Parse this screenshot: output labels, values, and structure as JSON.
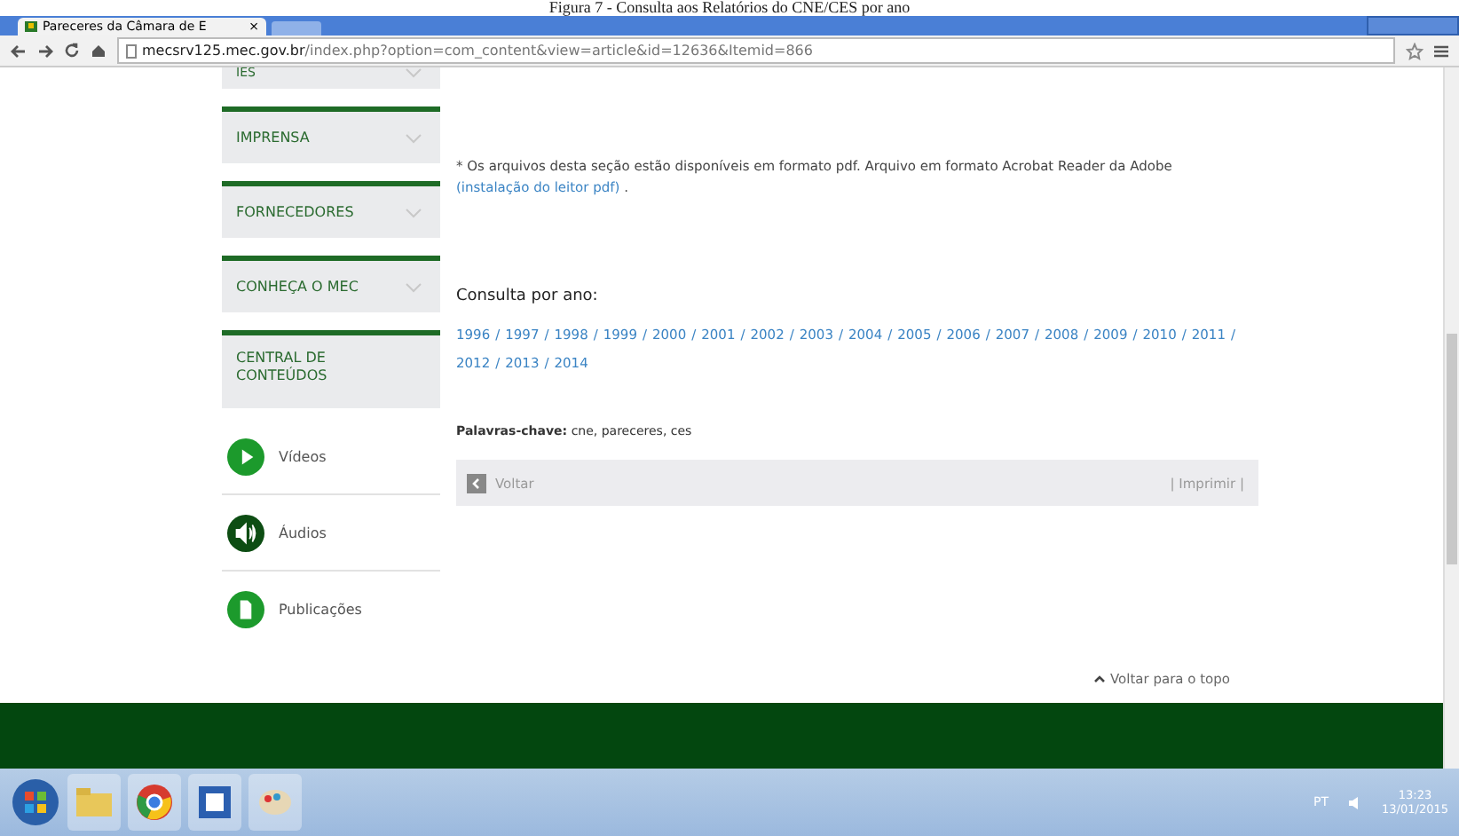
{
  "caption": "Figura 7 - Consulta aos Relatórios do CNE/CES por ano",
  "browser": {
    "tab": {
      "title": "Pareceres da Câmara de E",
      "close": "×"
    },
    "address": {
      "host": "mecsrv125.mec.gov.br",
      "path": "/index.php?option=com_content&view=article&id=12636&Itemid=866"
    }
  },
  "sidebar": {
    "menu": [
      {
        "label": "IES"
      },
      {
        "label": "IMPRENSA"
      },
      {
        "label": "FORNECEDORES"
      },
      {
        "label": "CONHEÇA O MEC"
      }
    ],
    "central": "CENTRAL DE CONTEÚDOS",
    "media": [
      {
        "kind": "video",
        "label": "Vídeos"
      },
      {
        "kind": "audio",
        "label": "Áudios"
      },
      {
        "kind": "document",
        "label": "Publicações"
      }
    ]
  },
  "content": {
    "note": "* Os arquivos desta seção estão disponíveis em formato pdf. Arquivo em formato Acrobat Reader da Adobe",
    "note_link": "(instalação do leitor pdf)",
    "note_end": " .",
    "heading": "Consulta por ano:",
    "separator": "/",
    "years": [
      "1996",
      "1997",
      "1998",
      "1999",
      "2000",
      "2001",
      "2002",
      "2003",
      "2004",
      "2005",
      "2006",
      "2007",
      "2008",
      "2009",
      "2010",
      "2011",
      "2012",
      "2013",
      "2014"
    ],
    "keywords_label": "Palavras-chave:",
    "keywords": "cne, pareceres, ces",
    "back": "Voltar",
    "print": "| Imprimir |",
    "top_link": "Voltar para o topo"
  },
  "taskbar": {
    "language": "PT",
    "time": "13:23",
    "date": "13/01/2015"
  }
}
